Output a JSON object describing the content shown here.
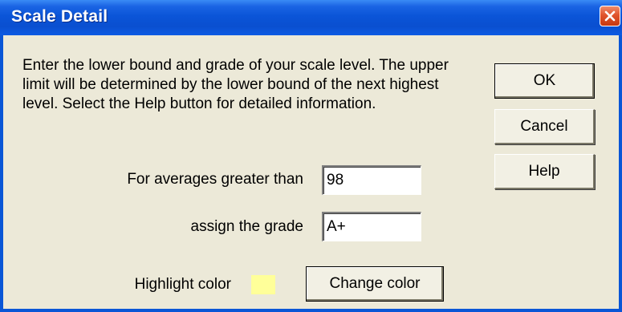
{
  "window": {
    "title": "Scale Detail"
  },
  "description": "Enter the lower bound and grade of your scale level. The upper limit will be determined by the lower bound of the next highest level. Select the Help button for detailed information.",
  "form": {
    "averages_label": "For averages greater than",
    "averages_value": "98",
    "grade_label": "assign the grade",
    "grade_value": "A+",
    "highlight_label": "Highlight color",
    "highlight_color": "#ffff99",
    "change_color_label": "Change color"
  },
  "buttons": {
    "ok_label": "OK",
    "cancel_label": "Cancel",
    "help_label": "Help"
  },
  "colors": {
    "titlebar": "#0a56d6",
    "close_button": "#e0542c",
    "window_bg": "#ece9d8"
  },
  "icons": {
    "close": "close-icon"
  }
}
